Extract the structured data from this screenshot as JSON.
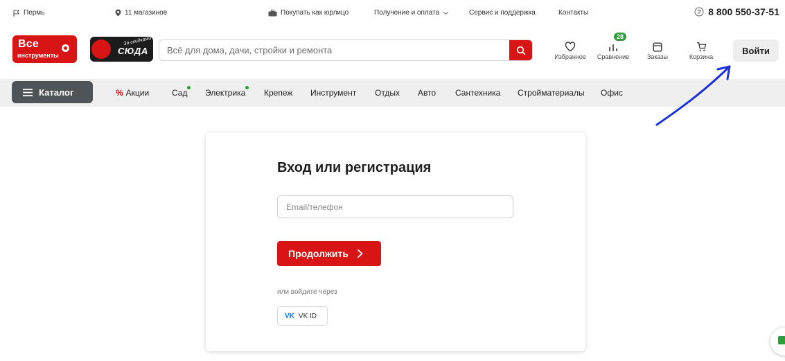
{
  "topbar": {
    "city": "Пермь",
    "stores": "11 магазинов",
    "legal": "Покупать как юрлицо",
    "delivery": "Получение и оплата",
    "service": "Сервис и поддержка",
    "contacts": "Контакты",
    "phone": "8 800 550-37-51"
  },
  "header": {
    "logo_line1": "Все",
    "logo_line2": "инструменты",
    "promo_small": "За скидками",
    "promo_big": "СЮДА",
    "search_placeholder": "Всё для дома, дачи, стройки и ремонта",
    "favorites": "Избранное",
    "compare": "Сравнение",
    "compare_count": "28",
    "orders": "Заказы",
    "cart": "Корзина",
    "login": "Войти"
  },
  "nav": {
    "catalog": "Каталог",
    "items": [
      "Акции",
      "Сад",
      "Электрика",
      "Крепеж",
      "Инструмент",
      "Отдых",
      "Авто",
      "Сантехника",
      "Стройматериалы",
      "Офис"
    ]
  },
  "login_card": {
    "title": "Вход или регистрация",
    "email_placeholder": "Email/телефон",
    "continue": "Продолжить",
    "or_via": "или войдите через",
    "vk_mark": "VK",
    "vk_id": "VK ID"
  },
  "colors": {
    "brand_red": "#d81414",
    "catalog_gray": "#4f5459",
    "badge_green": "#2c9e3b",
    "arrow_blue": "#1a2fd6",
    "vk_blue": "#0077ff"
  }
}
